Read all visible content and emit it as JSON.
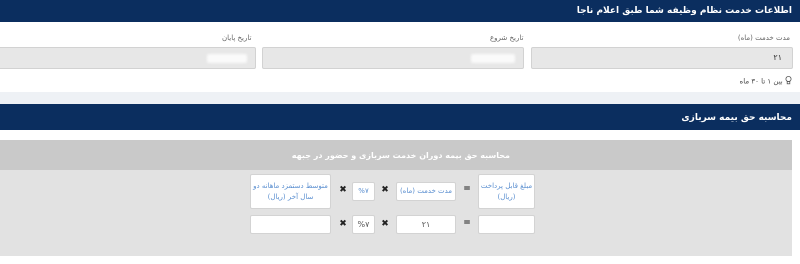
{
  "service_section": {
    "title": "اطلاعات خدمت نظام وظیفه شما طبق اعلام ناجا",
    "duration_label": "مدت خدمت (ماه)",
    "duration_value": "۲۱",
    "start_label": "تاریخ شروع",
    "end_label": "تاریخ پایان",
    "hint": "بین ۱ تا ۳۰ ماه"
  },
  "calc_section": {
    "title": "محاسبه حق بیمه سربازی",
    "panel_title": "محاسبه حق بیمه دوران خدمت سربازی و حضور در جبهه",
    "formula": {
      "payable_label": "مبلغ قابل پرداخت (ریال)",
      "equals": "=",
      "duration_label": "مدت خدمت (ماه)",
      "times": "✖",
      "percent": "%۷",
      "average_label": "متوسط دستمزد ماهانه دو سال آخر (ریال)"
    },
    "inputs": {
      "payable_value": "",
      "duration_value": "۲۱",
      "percent_value": "%۷",
      "average_value": ""
    }
  },
  "colors": {
    "header_bg": "#0b2e5f",
    "panel_head_bg": "#c9c9c9",
    "label_blue": "#5b8fd0"
  },
  "icons": {
    "hint": "lightbulb-icon"
  }
}
